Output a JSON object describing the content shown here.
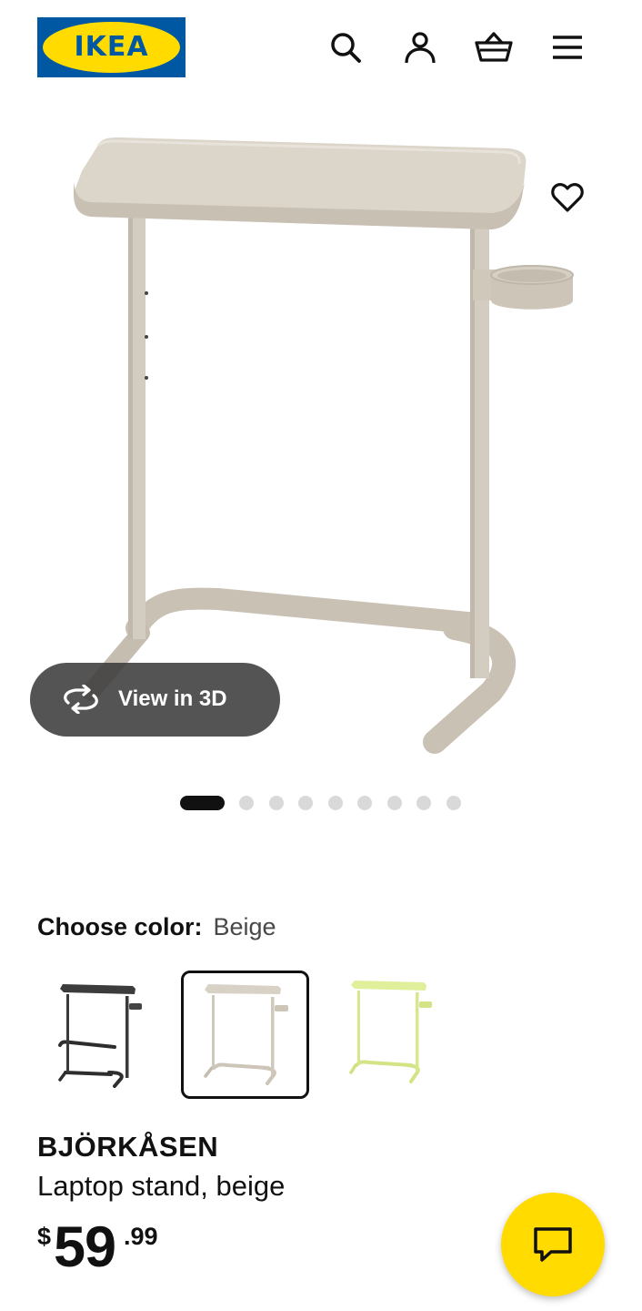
{
  "header": {
    "logo_text": "IKEA",
    "icons": [
      "search-icon",
      "account-icon",
      "cart-icon",
      "menu-icon"
    ]
  },
  "gallery": {
    "view3d_label": "View in 3D",
    "slide_count": 9,
    "active_slide": 1
  },
  "color_picker": {
    "label": "Choose color:",
    "selected": "Beige",
    "options": [
      {
        "name": "black",
        "color": "#3a3a3a"
      },
      {
        "name": "beige",
        "color": "#cfc8bd"
      },
      {
        "name": "light green",
        "color": "#d8eb8a"
      }
    ]
  },
  "product": {
    "name": "BJÖRKÅSEN",
    "description": "Laptop stand, beige",
    "price_currency": "$",
    "price_integer": "59",
    "price_decimal": ".99"
  },
  "colors": {
    "ikea_blue": "#0058a3",
    "ikea_yellow": "#ffdb00",
    "product_beige": "#cfc8bd"
  }
}
